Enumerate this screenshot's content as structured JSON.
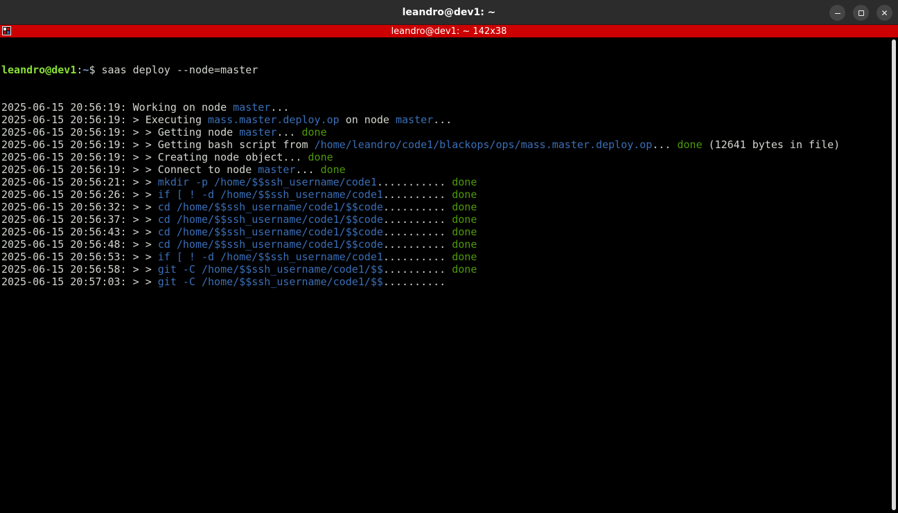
{
  "window": {
    "title": "leandro@dev1: ~",
    "buttons": {
      "minimize": "minimize-icon",
      "restore": "restore-icon",
      "close": "✕"
    }
  },
  "tmux": {
    "title": "leandro@dev1: ~ 142x38",
    "bar_color": "#cc0000"
  },
  "prompt": {
    "user_host": "leandro@dev1",
    "sep": ":",
    "path": "~",
    "symbol": "$ ",
    "command": "saas deploy --node=master"
  },
  "lines": [
    {
      "ts": "2025-06-15 20:56:19:",
      "pre": " Working on node ",
      "hl": "master",
      "mid": "...",
      "done": "",
      "post": ""
    },
    {
      "ts": "2025-06-15 20:56:19:",
      "pre": " > Executing ",
      "hl": "mass.master.deploy.op",
      "mid": " on node ",
      "hl2": "master",
      "mid2": "...",
      "done": "",
      "post": ""
    },
    {
      "ts": "2025-06-15 20:56:19:",
      "pre": " > > Getting node ",
      "hl": "master",
      "mid": "... ",
      "done": "done",
      "post": ""
    },
    {
      "ts": "2025-06-15 20:56:19:",
      "pre": " > > Getting bash script from ",
      "hl": "/home/leandro/code1/blackops/ops/mass.master.deploy.op",
      "mid": "... ",
      "done": "done",
      "post": " (12641 bytes in file)"
    },
    {
      "ts": "2025-06-15 20:56:19:",
      "pre": " > > Creating node object... ",
      "hl": "",
      "mid": "",
      "done": "done",
      "post": ""
    },
    {
      "ts": "2025-06-15 20:56:19:",
      "pre": " > > Connect to node ",
      "hl": "master",
      "mid": "... ",
      "done": "done",
      "post": ""
    },
    {
      "ts": "2025-06-15 20:56:21:",
      "pre": " > > ",
      "hl": "mkdir -p /home/$$ssh_username/code1",
      "mid": "........... ",
      "done": "done",
      "post": ""
    },
    {
      "ts": "2025-06-15 20:56:26:",
      "pre": " > > ",
      "hl": "if [ ! -d /home/$$ssh_username/code1",
      "mid": ".......... ",
      "done": "done",
      "post": ""
    },
    {
      "ts": "2025-06-15 20:56:32:",
      "pre": " > > ",
      "hl": "cd /home/$$ssh_username/code1/$$code",
      "mid": ".......... ",
      "done": "done",
      "post": ""
    },
    {
      "ts": "2025-06-15 20:56:37:",
      "pre": " > > ",
      "hl": "cd /home/$$ssh_username/code1/$$code",
      "mid": ".......... ",
      "done": "done",
      "post": ""
    },
    {
      "ts": "2025-06-15 20:56:43:",
      "pre": " > > ",
      "hl": "cd /home/$$ssh_username/code1/$$code",
      "mid": ".......... ",
      "done": "done",
      "post": ""
    },
    {
      "ts": "2025-06-15 20:56:48:",
      "pre": " > > ",
      "hl": "cd /home/$$ssh_username/code1/$$code",
      "mid": ".......... ",
      "done": "done",
      "post": ""
    },
    {
      "ts": "2025-06-15 20:56:53:",
      "pre": " > > ",
      "hl": "if [ ! -d /home/$$ssh_username/code1",
      "mid": ".......... ",
      "done": "done",
      "post": ""
    },
    {
      "ts": "2025-06-15 20:56:58:",
      "pre": " > > ",
      "hl": "git -C /home/$$ssh_username/code1/$$",
      "mid": ".......... ",
      "done": "done",
      "post": ""
    },
    {
      "ts": "2025-06-15 20:57:03:",
      "pre": " > > ",
      "hl": "git -C /home/$$ssh_username/code1/$$",
      "mid": "..........",
      "done": "",
      "post": ""
    }
  ]
}
